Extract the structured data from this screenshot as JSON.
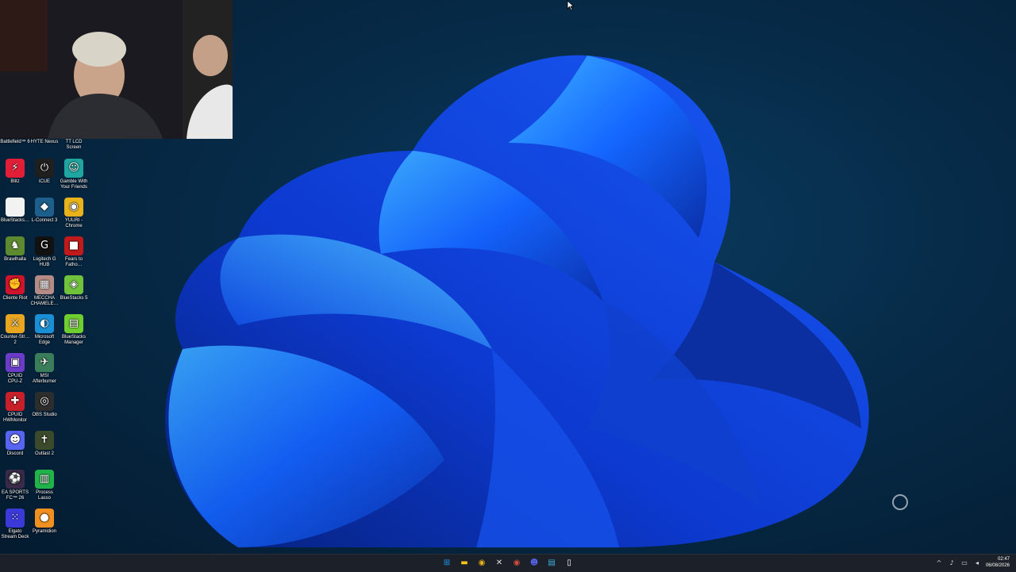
{
  "desktop": {
    "top_row": [
      {
        "label": "Battlefield™ 6"
      },
      {
        "label": "HYTE Nexus"
      },
      {
        "label": "TT LCD\nScreen"
      }
    ],
    "icons": [
      {
        "label": "Blitz",
        "icon": "lightning-bolt",
        "glyph": "⚡",
        "color": "#e01e37"
      },
      {
        "label": "iCUE",
        "icon": "power-ring",
        "glyph": "⏻",
        "color": "#1f1f1f"
      },
      {
        "label": "Gamble With\nYour Friends",
        "icon": "dice-face",
        "glyph": "☺",
        "color": "#1fa6a0"
      },
      {
        "label": "BlueStacks…",
        "icon": "blank-file",
        "glyph": "",
        "color": "#f2f2f2"
      },
      {
        "label": "L-Connect 3",
        "icon": "multicolor-square",
        "glyph": "◆",
        "color": "#1d5f8a"
      },
      {
        "label": "YUURI -\nChrome",
        "icon": "chrome-logo",
        "glyph": "◉",
        "color": "#e8b21a"
      },
      {
        "label": "Brawlhalla",
        "icon": "brawlhalla-character",
        "glyph": "♞",
        "color": "#5e8a2f"
      },
      {
        "label": "Logitech G\nHUB",
        "icon": "logitech-g",
        "glyph": "G",
        "color": "#111111"
      },
      {
        "label": "Fears to\nFatho…",
        "icon": "game-cover",
        "glyph": "■",
        "color": "#c21a1a"
      },
      {
        "label": "Cliente Riot",
        "icon": "riot-fist",
        "glyph": "✊",
        "color": "#d0142c"
      },
      {
        "label": "MECCHA\nCHAMELE…",
        "icon": "game-cover",
        "glyph": "▦",
        "color": "#b58b86"
      },
      {
        "label": "BlueStacks 5",
        "icon": "bluestacks-stack",
        "glyph": "◈",
        "color": "#6fc23a"
      },
      {
        "label": "Counter-Str…\n2",
        "icon": "cs2-logo",
        "glyph": "⚔",
        "color": "#e8a620"
      },
      {
        "label": "Microsoft\nEdge",
        "icon": "edge-logo",
        "glyph": "◐",
        "color": "#1a8fd6"
      },
      {
        "label": "BlueStacks\nManager",
        "icon": "bluestacks-manager",
        "glyph": "▤",
        "color": "#6fcf2e"
      },
      {
        "label": "CPUID\nCPU-Z",
        "icon": "cpu-chip",
        "glyph": "▣",
        "color": "#6b3bc9"
      },
      {
        "label": "MSI\nAfterburner",
        "icon": "afterburner",
        "glyph": "✈",
        "color": "#3a7d5a"
      },
      {
        "label": "",
        "icon": "empty",
        "glyph": "",
        "color": "transparent"
      },
      {
        "label": "CPUID\nHWMonitor",
        "icon": "hwmonitor",
        "glyph": "✚",
        "color": "#c8202a"
      },
      {
        "label": "OBS Studio",
        "icon": "obs-logo",
        "glyph": "◎",
        "color": "#2d2d2d"
      },
      {
        "label": "",
        "icon": "empty",
        "glyph": "",
        "color": "transparent"
      },
      {
        "label": "Discord",
        "icon": "discord-logo",
        "glyph": "☻",
        "color": "#5865f2"
      },
      {
        "label": "Outlast 2",
        "icon": "outlast-cross",
        "glyph": "✝",
        "color": "#3a4a2a"
      },
      {
        "label": "",
        "icon": "empty",
        "glyph": "",
        "color": "transparent"
      },
      {
        "label": "EA SPORTS\nFC™ 26",
        "icon": "ea-fc",
        "glyph": "⚽",
        "color": "#3a2a4a"
      },
      {
        "label": "Process\nLasso",
        "icon": "bar-graph",
        "glyph": "▥",
        "color": "#22b24a"
      },
      {
        "label": "",
        "icon": "empty",
        "glyph": "",
        "color": "transparent"
      },
      {
        "label": "Elgato\nStream Deck",
        "icon": "stream-deck-grid",
        "glyph": "⁙",
        "color": "#3b3ad8"
      },
      {
        "label": "Pyramidion",
        "icon": "pyramidion-orb",
        "glyph": "●",
        "color": "#f09020"
      }
    ]
  },
  "taskbar": {
    "apps": [
      {
        "name": "start-button",
        "icon": "windows-logo",
        "glyph": "⊞",
        "color": "#1a9bf0"
      },
      {
        "name": "file-explorer-button",
        "icon": "folder-icon",
        "glyph": "▬",
        "color": "#f5c518"
      },
      {
        "name": "chrome-button",
        "icon": "chrome-logo",
        "glyph": "◉",
        "color": "#e8b21a"
      },
      {
        "name": "app-x-button",
        "icon": "x-logo",
        "glyph": "✕",
        "color": "#e0e0e0"
      },
      {
        "name": "chrome-alt-button",
        "icon": "chrome-profile",
        "glyph": "◉",
        "color": "#d84a3a"
      },
      {
        "name": "discord-taskbar-button",
        "icon": "discord-logo",
        "glyph": "☻",
        "color": "#5865f2"
      },
      {
        "name": "notepad-button",
        "icon": "notepad-icon",
        "glyph": "▤",
        "color": "#3bb5e6"
      },
      {
        "name": "file-button",
        "icon": "file-icon",
        "glyph": "▯",
        "color": "#ffffff"
      }
    ],
    "tray": [
      {
        "name": "tray-overflow",
        "icon": "chevron-up-icon",
        "glyph": "^"
      },
      {
        "name": "microphone",
        "icon": "microphone-icon",
        "glyph": "♪"
      },
      {
        "name": "network",
        "icon": "network-icon",
        "glyph": "▭"
      },
      {
        "name": "volume",
        "icon": "speaker-icon",
        "glyph": "◂"
      }
    ],
    "clock": {
      "time": "02:47",
      "date": "06/08/2026"
    }
  }
}
